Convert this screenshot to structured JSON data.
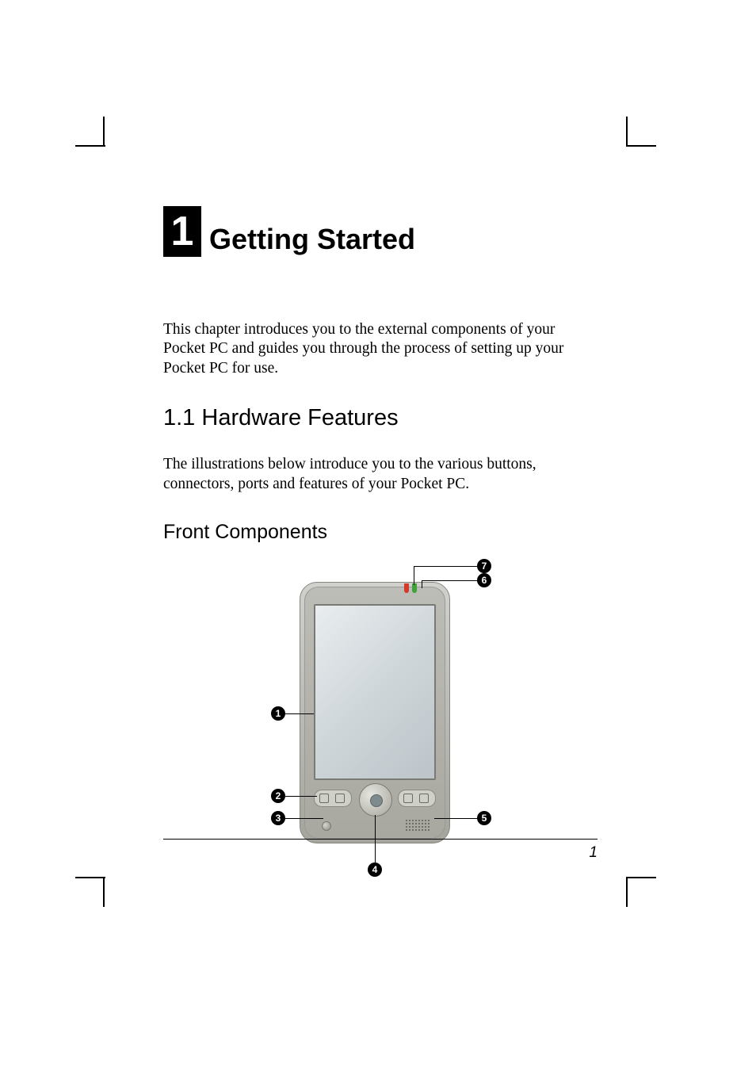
{
  "chapter": {
    "number": "1",
    "title": "Getting Started"
  },
  "intro_para": "This chapter introduces you to the external components of your Pocket PC and guides you through the process of setting up your Pocket PC for use.",
  "section": {
    "number_title": "1.1   Hardware Features",
    "para": "The illustrations below introduce you to the various buttons, connectors, ports and features of your Pocket PC."
  },
  "subsection": {
    "title": "Front Components"
  },
  "callouts": {
    "n1": "1",
    "n2": "2",
    "n3": "3",
    "n4": "4",
    "n5": "5",
    "n6": "6",
    "n7": "7"
  },
  "page_number": "1"
}
